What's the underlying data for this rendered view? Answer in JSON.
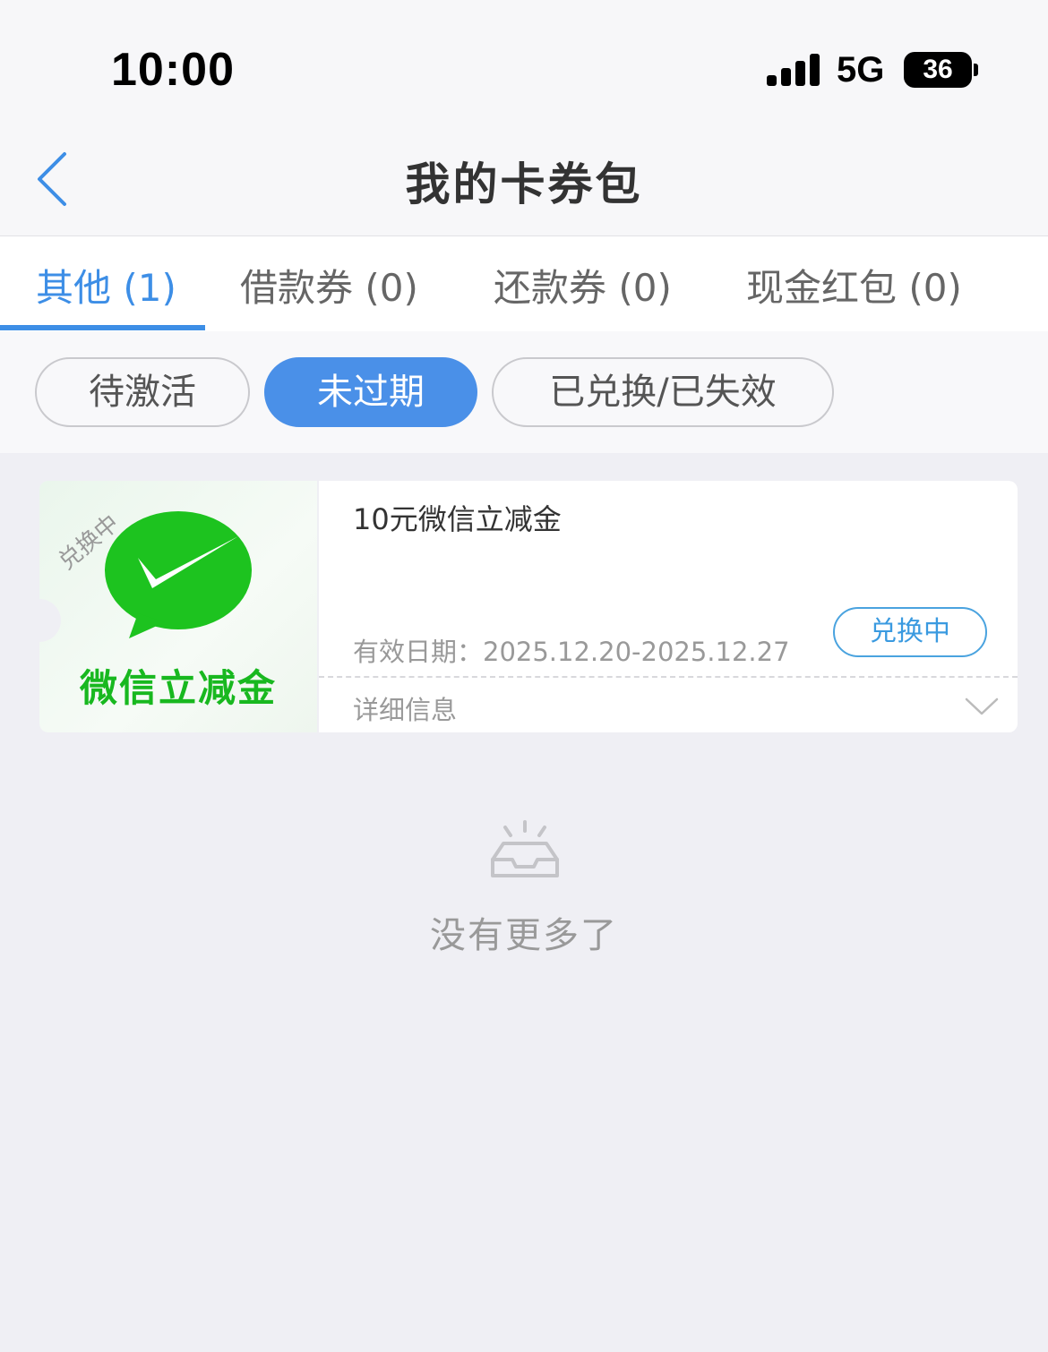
{
  "status_bar": {
    "time": "10:00",
    "network": "5G",
    "battery": "36"
  },
  "navbar": {
    "title": "我的卡券包",
    "back_icon": "chevron-left-icon"
  },
  "tabs": [
    {
      "label": "其他 (1)",
      "active": true
    },
    {
      "label": "借款券 (0)",
      "active": false
    },
    {
      "label": "还款券 (0)",
      "active": false
    },
    {
      "label": "现金红包 (0)",
      "active": false
    }
  ],
  "filters": [
    {
      "label": "待激活",
      "active": false
    },
    {
      "label": "未过期",
      "active": true
    },
    {
      "label": "已兑换/已失效",
      "active": false
    }
  ],
  "coupon": {
    "stamp": "兑换中",
    "brand_label": "微信立减金",
    "title": "10元微信立减金",
    "validity": "有效日期：2025.12.20-2025.12.27",
    "status_button": "兑换中",
    "detail_label": "详细信息",
    "icon": "wechat-icon"
  },
  "empty_state": {
    "text": "没有更多了",
    "icon": "empty-inbox-icon"
  },
  "colors": {
    "accent": "#4a90e8",
    "tab_active": "#3d8ee6",
    "wechat_green": "#18b81f",
    "background": "#efeff4"
  }
}
